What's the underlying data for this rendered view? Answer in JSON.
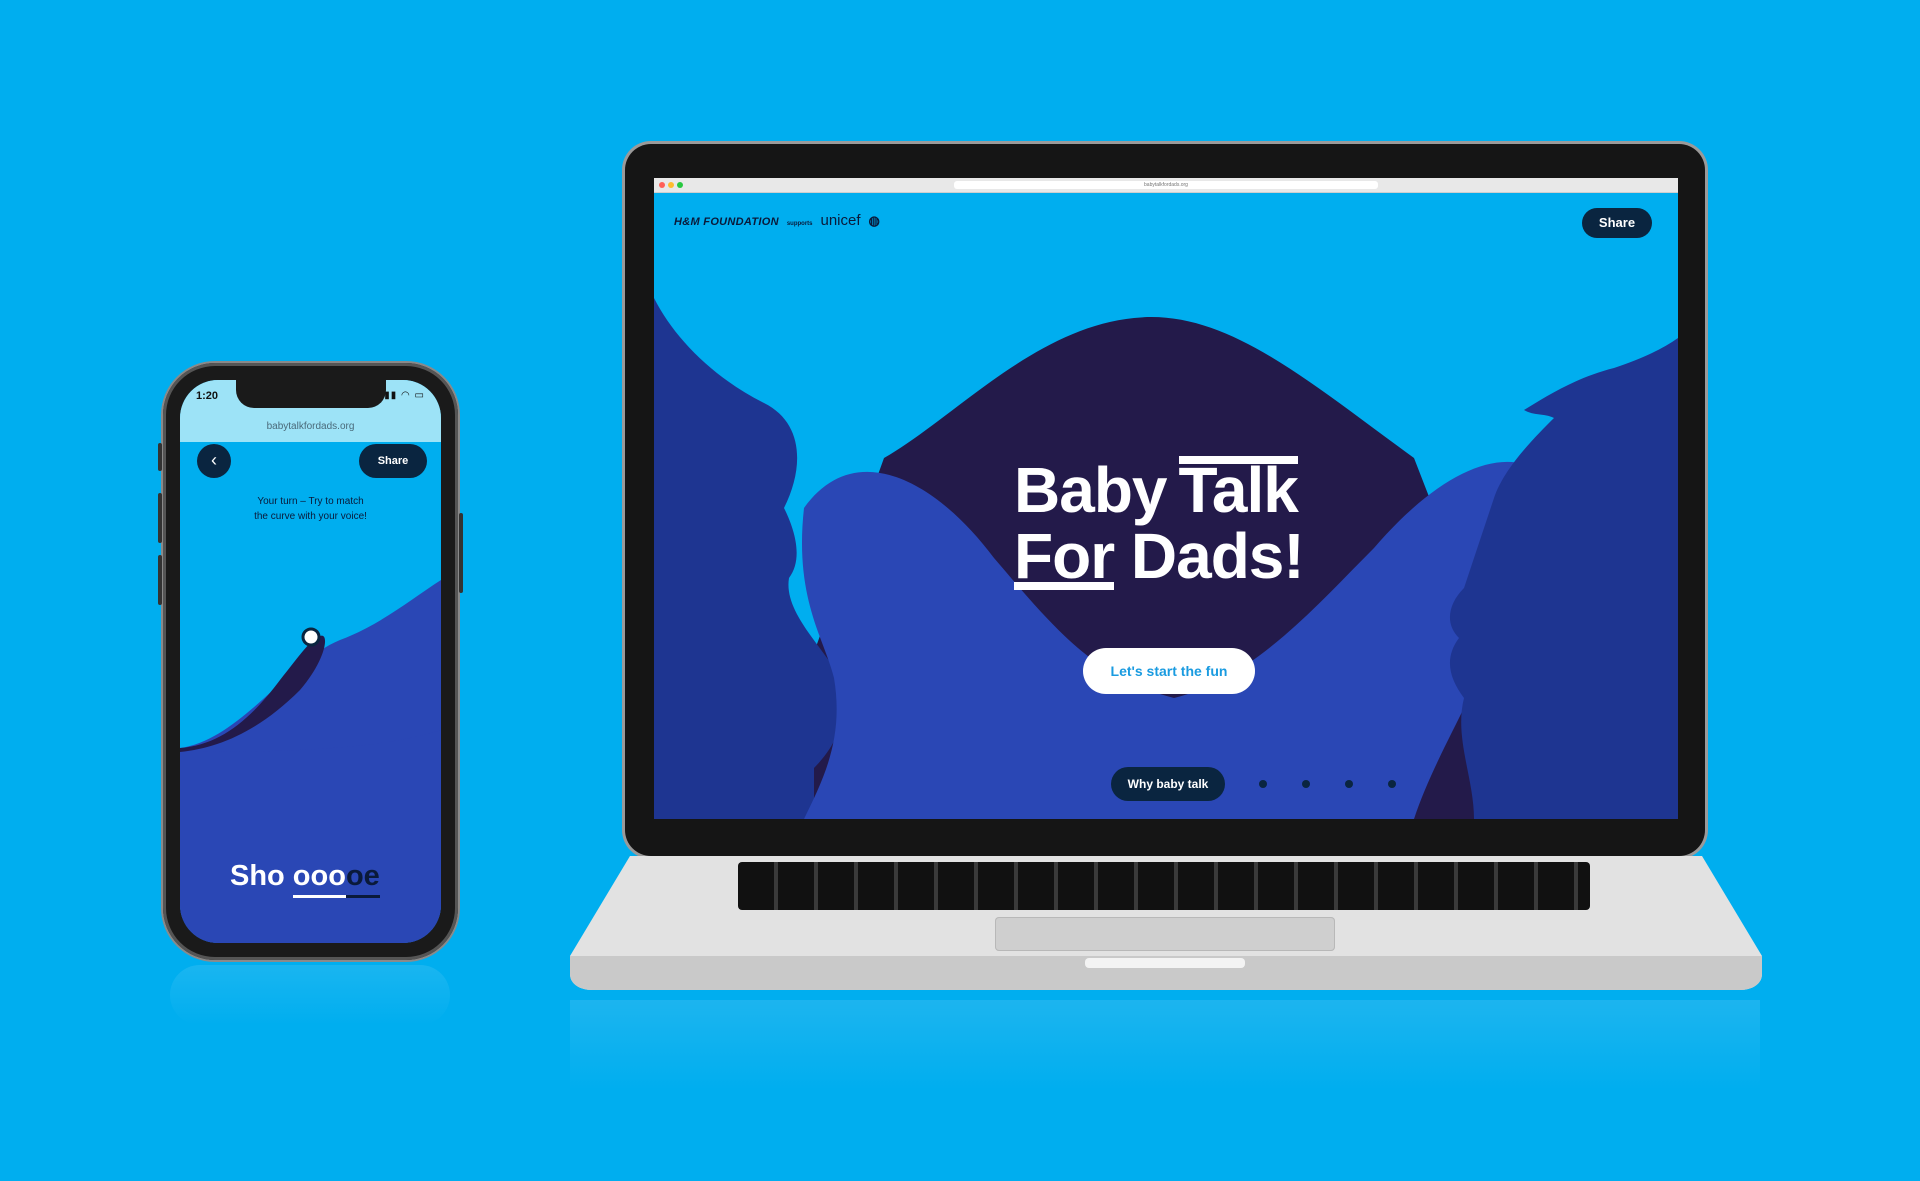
{
  "colors": {
    "background": "#00aeef",
    "navy": "#0a2540",
    "deep_purple": "#231a4a",
    "hill_blue": "#2a47b5",
    "face_blue": "#1e3591",
    "white": "#ffffff",
    "cta_text": "#1a9be0"
  },
  "phone": {
    "status_time": "1:20",
    "status_icons": "signal wifi battery",
    "url": "babytalkfordads.org",
    "back_icon": "chevron-left-icon",
    "share_label": "Share",
    "instruction_line1": "Your turn – Try to match",
    "instruction_line2": "the curve with your voice!",
    "word_prefix": "Sho",
    "word_vowels_active": "ooo",
    "word_vowels_rest": "oe"
  },
  "laptop": {
    "browser_url": "babytalkfordads.org",
    "brand_hm": "H&M FOUNDATION",
    "brand_supports": "supports",
    "brand_unicef": "unicef",
    "share_label": "Share",
    "title_line1_a": "Baby",
    "title_line1_b": "Talk",
    "title_line2_a": "For",
    "title_line2_b": "Dads!",
    "cta_label": "Let's start the fun",
    "why_label": "Why baby talk",
    "pagination_dots": 4
  }
}
